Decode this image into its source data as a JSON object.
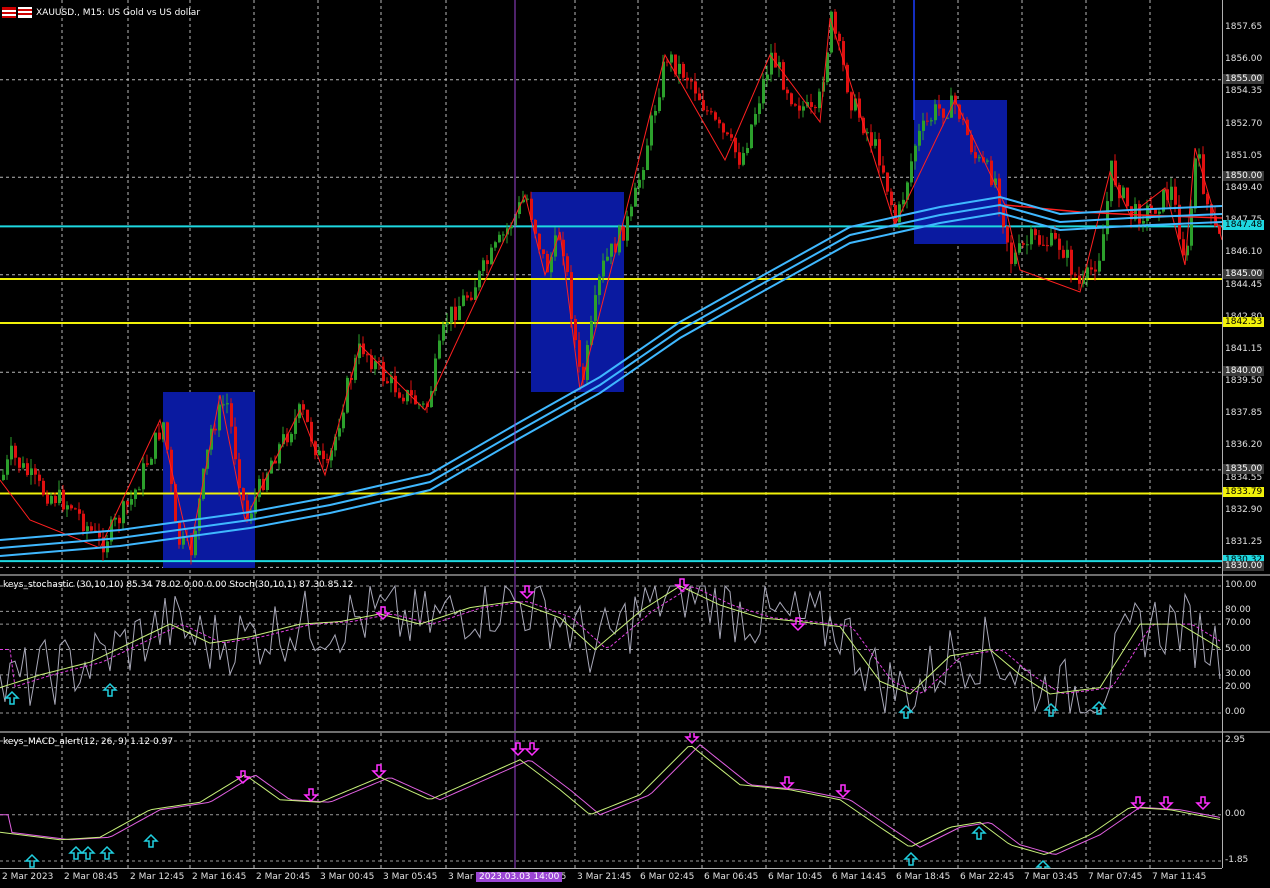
{
  "title": "XAUUSD., M15:  US Gold vs US dollar",
  "stoch_title": "keys_stochastic (30,10,10) 85.34 78.02 0.00 0.00 Stoch(30,10,1) 87.30 85.12",
  "macd_title": "keys_MACD_alert(12, 26, 9) 1.12 0.97",
  "price_axis": [
    "1857.65",
    "1856.00",
    "1854.35",
    "1852.70",
    "1851.05",
    "1849.40",
    "1847.75",
    "1846.10",
    "1844.45",
    "1842.80",
    "1841.15",
    "1839.50",
    "1837.85",
    "1836.20",
    "1834.55",
    "1832.90",
    "1831.25"
  ],
  "price_tags": [
    {
      "text": "1855.00",
      "bg": "#3a3a3a",
      "fg": "#ffffff"
    },
    {
      "text": "1850.00",
      "bg": "#3a3a3a",
      "fg": "#ffffff"
    },
    {
      "text": "1847.48",
      "bg": "#1ed8e0",
      "fg": "#000000"
    },
    {
      "text": "1845.00",
      "bg": "#3a3a3a",
      "fg": "#ffffff"
    },
    {
      "text": "1842.53",
      "bg": "#f1f10a",
      "fg": "#000000"
    },
    {
      "text": "1840.00",
      "bg": "#3a3a3a",
      "fg": "#ffffff"
    },
    {
      "text": "1835.00",
      "bg": "#3a3a3a",
      "fg": "#ffffff"
    },
    {
      "text": "1833.79",
      "bg": "#f1f10a",
      "fg": "#000000"
    },
    {
      "text": "1830.32",
      "bg": "#1ed8e0",
      "fg": "#000000"
    },
    {
      "text": "1830.00",
      "bg": "#3a3a3a",
      "fg": "#ffffff"
    }
  ],
  "stoch_axis": [
    "100.00",
    "80.00",
    "70.00",
    "50.00",
    "30.00",
    "20.00",
    "0.00"
  ],
  "macd_axis": [
    "2.95",
    "0.00",
    "-1.85"
  ],
  "time_axis": [
    "2 Mar 2023",
    "2 Mar 08:45",
    "2 Mar 12:45",
    "2 Mar 16:45",
    "2 Mar 20:45",
    "3 Mar 00:45",
    "3 Mar 05:45",
    "3 Mar",
    "3 Mar 17:45",
    "3 Mar 21:45",
    "6 Mar 02:45",
    "6 Mar 06:45",
    "6 Mar 10:45",
    "6 Mar 14:45",
    "6 Mar 18:45",
    "6 Mar 22:45",
    "7 Mar 03:45",
    "7 Mar 07:45",
    "7 Mar 11:45"
  ],
  "cursor_time": "2023.03.03 14:00",
  "colors": {
    "bull": "#2ca02c",
    "bear": "#e01010",
    "ma": "#3fb8ff",
    "cyan": "#1ed8e0",
    "yellow": "#f1f10a",
    "box": "#0a1aa0",
    "zigzag": "#ff2020",
    "cursor": "#9b45d4",
    "arrow_up": "#20d0e0",
    "arrow_down": "#ff30ff"
  }
}
